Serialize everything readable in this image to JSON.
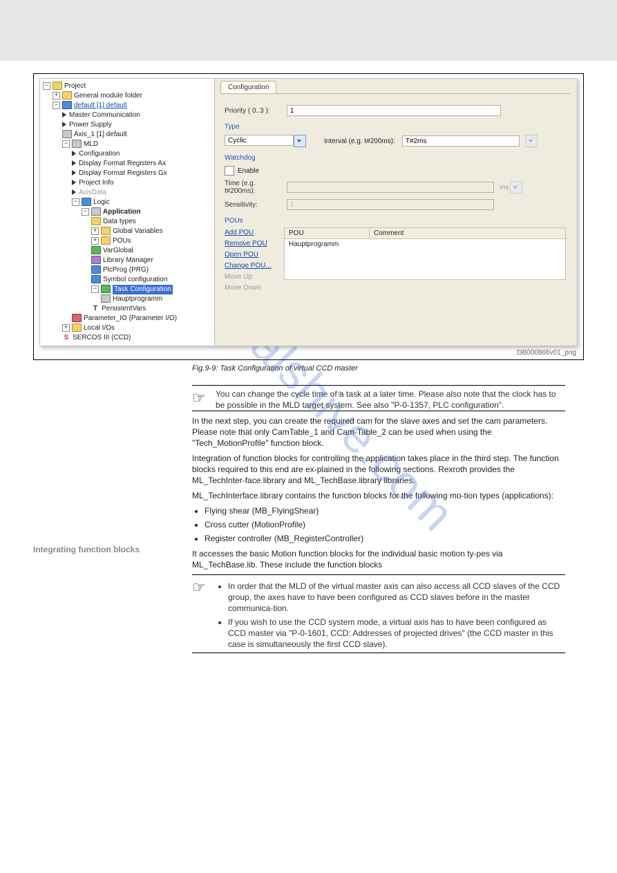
{
  "tree": {
    "root": "Project",
    "general_folder": "General module folder",
    "default": "default [1] default",
    "master_comm": "Master Communication",
    "power_supply": "Power Supply",
    "axis": "Axis_1 [1] default",
    "mld": "MLD",
    "configuration": "Configuration",
    "disp_ax": "Display Format Registers Ax",
    "disp_gx": "Display Format Registers Gx",
    "project_info": "Project Info",
    "axis_data": "AxisData",
    "logic": "Logic",
    "application": "Application",
    "data_types": "Data types",
    "global_vars": "Global Variables",
    "pous": "POUs",
    "varglobal": "VarGlobal",
    "library_mgr": "Library Manager",
    "plcprog": "PlcProg (PRG)",
    "symbol_cfg": "Symbol configuration",
    "task_cfg": "Task Configuration",
    "hauptprog": "Hauptprogramm",
    "persistent": "PersistentVars",
    "param_io": "Parameter_IO (Parameter I/O)",
    "local_ios": "Local I/Os",
    "sercos": "SERCOS III (CCD)"
  },
  "form": {
    "tab": "Configuration",
    "priority_lbl": "Priority ( 0..3 ):",
    "priority_val": "1",
    "type_lbl": "Type",
    "type_val": "Cyclic",
    "interval_lbl": "Interval (e.g. t#200ms):",
    "interval_val": "T#2ms",
    "watchdog_lbl": "Watchdog",
    "enable_lbl": "Enable",
    "time_lbl": "Time (e.g. t#200ms):",
    "time_val": "",
    "time_unit": "ms",
    "sens_lbl": "Sensitivity:",
    "sens_val": "1",
    "pous_lbl": "POUs",
    "add_pou": "Add POU",
    "remove_pou": "Remove POU",
    "open_pou": "Open POU",
    "change_pou": "Change POU...",
    "move_up": "Move Up",
    "move_down": "Move Down",
    "head_pou": "POU",
    "head_comment": "Comment",
    "row1": "Hauptprogramm"
  },
  "fig_src": "DB000866v01_png",
  "fig_caption": "Fig.9-9: Task Configuration of virtual CCD master",
  "note1": "You can change the cycle time of a task at a later time. Please also note that the clock has to be possible in the MLD target system. See also \"P-0-1357, PLC configuration\".",
  "para1": "In the next step, you can create the required cam for the slave axes and set the cam parameters. Please note that only CamTable_1 and Cam‐Table_2 can be used when using the \"Tech_MotionProfile\" function block.",
  "para2": "Integration of function blocks for controlling the application takes place in the third step. The function blocks required to this end are ex‐plained in the following sections. Rexroth provides the ML_TechInter‐face.library and ML_TechBase.library libraries.",
  "side_heading1": "Integrating function blocks",
  "para3": "ML_TechInterface.library contains the function blocks for the following mo‐tion types (applications):",
  "bullets": [
    "Flying shear (MB_FlyingShear)",
    "Cross cutter (MotionProfile)",
    "Register controller (MB_RegisterController)"
  ],
  "para4": "It accesses the basic Motion function blocks for the individual basic motion ty‐pes via ML_TechBase.lib. These include the function blocks",
  "note2_l1": "In order that the MLD of the virtual master axis can also access all CCD slaves of the CCD group, the axes have to have been configured as CCD slaves before in the master communica‐tion.",
  "note2_l2": "If you wish to use the CCD system mode, a virtual axis has to have been configured as CCD master via \"P-0-1601, CCD: Addresses of projected drives\" (the CCD master in this case is simultaneously the first CCD slave).",
  "watermark": "manualshive.com"
}
